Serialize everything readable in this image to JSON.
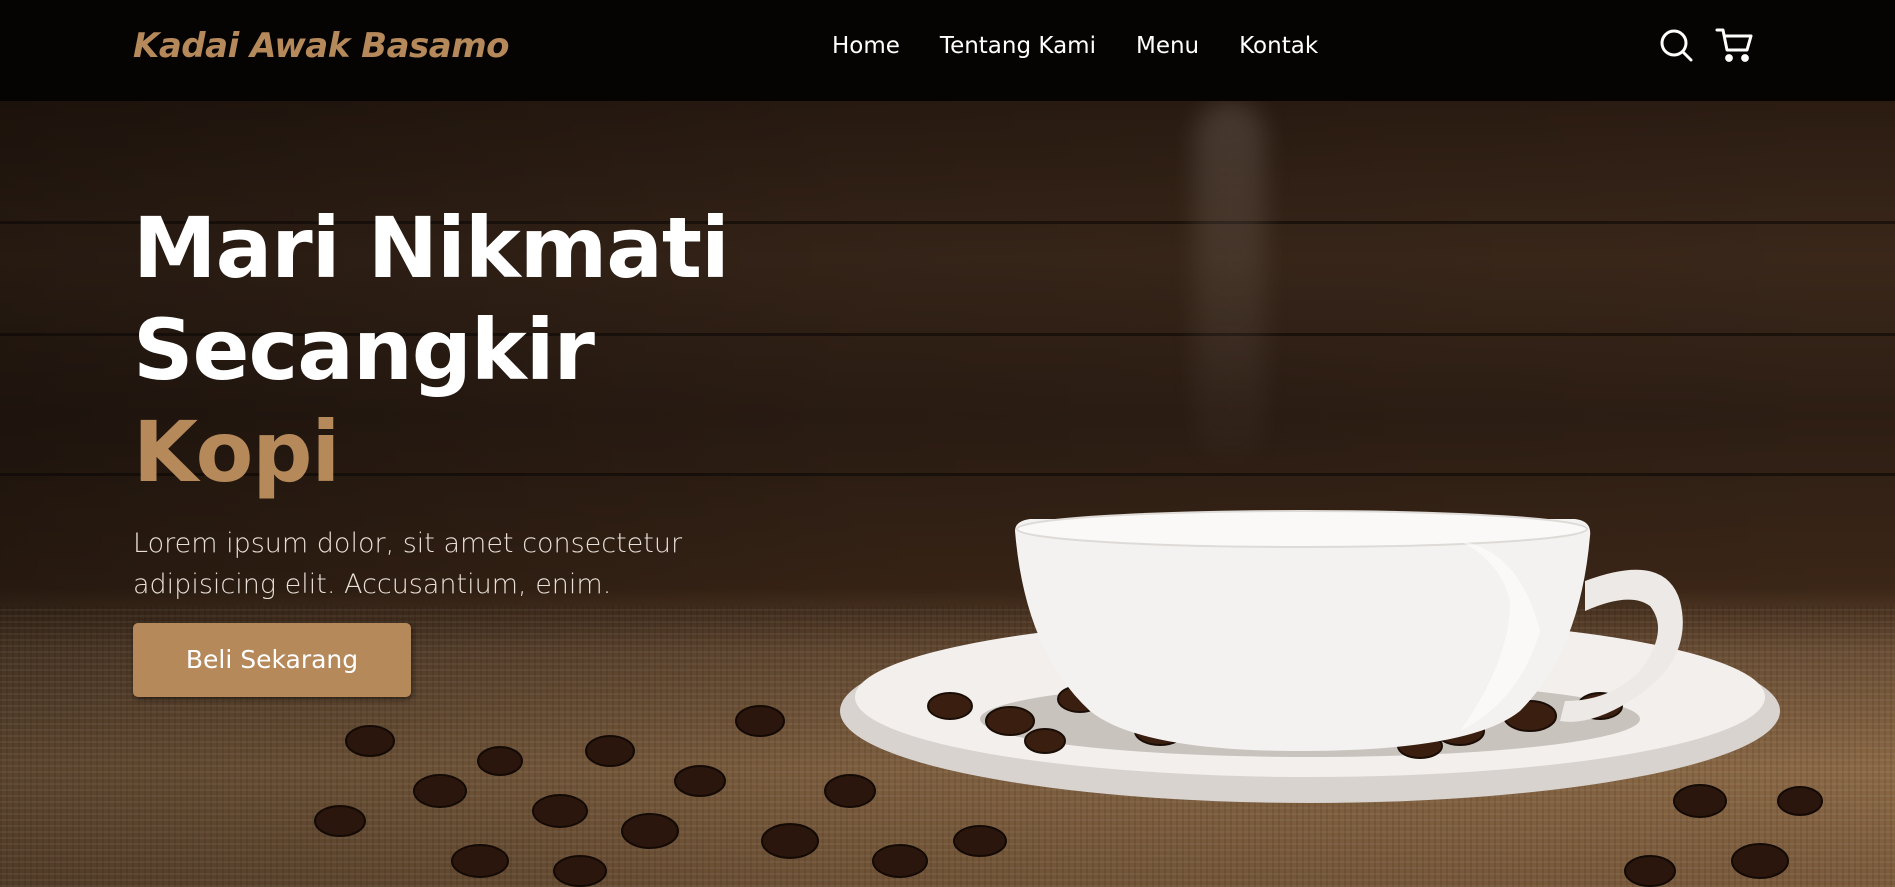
{
  "navbar": {
    "logo": "Kadai Awak Basamo",
    "links": [
      "Home",
      "Tentang Kami",
      "Menu",
      "Kontak"
    ],
    "icons": [
      "search-icon",
      "cart-icon"
    ]
  },
  "hero": {
    "title_line1": "Mari Nikmati",
    "title_line2": "Secangkir",
    "title_accent": "Kopi",
    "description": "Lorem ipsum dolor, sit amet consectetur adipisicing elit. Accusantium, enim.",
    "cta_label": "Beli Sekarang"
  },
  "colors": {
    "accent": "#b6895b",
    "navbar_bg": "#050403",
    "text": "#ffffff"
  }
}
